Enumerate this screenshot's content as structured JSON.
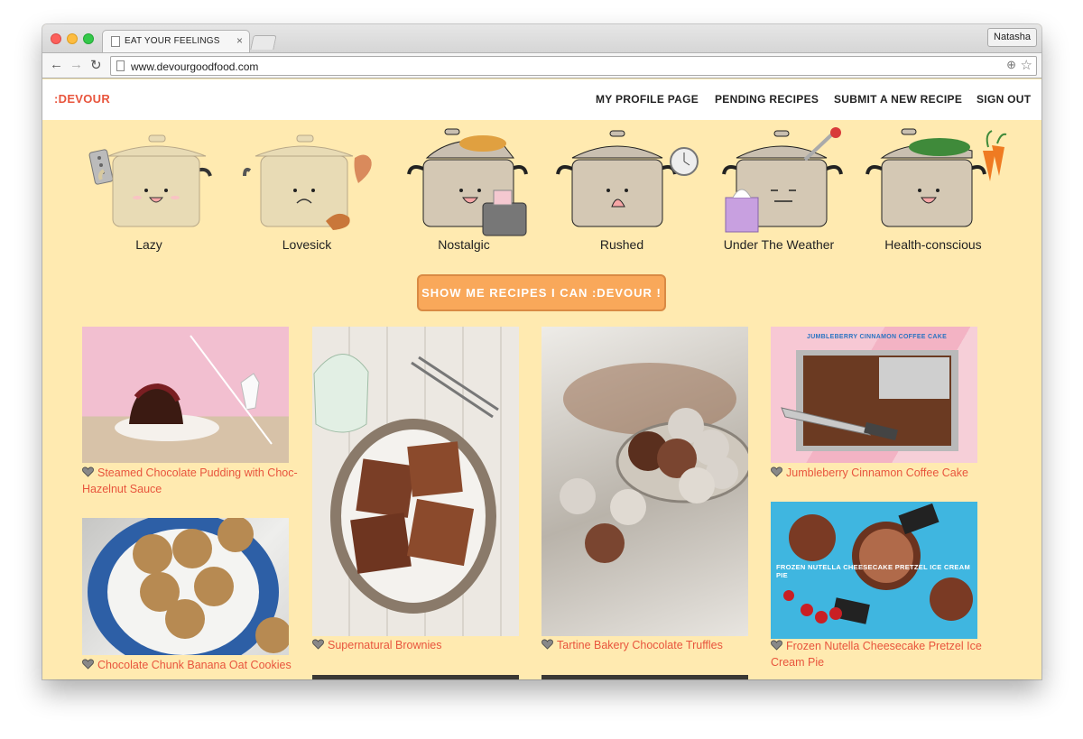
{
  "browser": {
    "tab_title": "EAT YOUR FEELINGS",
    "tab_close": "×",
    "profile_name": "Natasha",
    "url": "www.devourgoodfood.com",
    "icons": [
      "back-arrow-icon",
      "forward-arrow-icon",
      "reload-icon",
      "zoom-icon",
      "star-icon"
    ]
  },
  "site": {
    "logo": ":DEVOUR",
    "nav": [
      "MY PROFILE PAGE",
      "PENDING RECIPES",
      "SUBMIT A NEW RECIPE",
      "SIGN OUT"
    ],
    "moods": [
      "Lazy",
      "Lovesick",
      "Nostalgic",
      "Rushed",
      "Under The Weather",
      "Health-conscious"
    ],
    "cta": "SHOW ME RECIPES I CAN :DEVOUR !",
    "recipes": [
      "Steamed Chocolate Pudding with Choc-Hazelnut Sauce",
      "Chocolate Chunk Banana Oat Cookies",
      "Supernatural Brownies",
      "Tartine Bakery Chocolate Truffles",
      "Jumbleberry Cinnamon Coffee Cake",
      "Frozen Nutella Cheesecake Pretzel Ice Cream Pie"
    ],
    "photo_text": {
      "jumbleberry": "JUMBLEBERRY CINNAMON COFFEE CAKE",
      "frozen_pie": "FROZEN NUTELLA CHEESECAKE PRETZEL ICE CREAM PIE"
    }
  },
  "colors": {
    "page_background": "#ffeab0",
    "brand": "#e8553d",
    "cta": "#f9a85a"
  }
}
